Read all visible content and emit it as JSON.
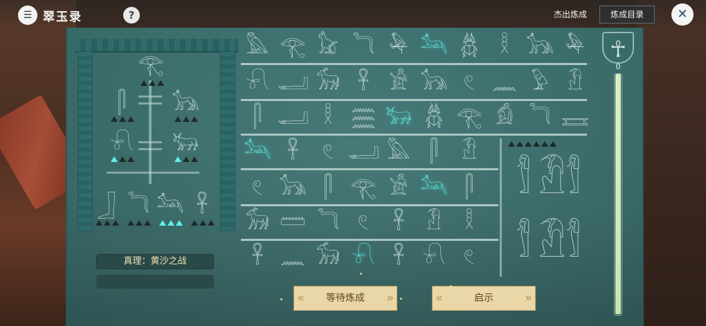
{
  "header": {
    "app_title": "翠玉录",
    "logo_glyph": "☰",
    "help_glyph": "?",
    "excellent_label": "杰出炼成",
    "catalog_label": "炼成目录",
    "close_glyph": "✕"
  },
  "left_panel": {
    "truth_label": "真理：黄沙之战",
    "tree_glyphs": [
      "𓂀",
      "𓋴",
      "𓃥",
      "𓍯",
      "𓃒",
      "𓃀",
      "𓆓",
      "𓃢",
      "𓋹"
    ]
  },
  "grid": {
    "rows": [
      [
        "𓅓",
        "𓂀",
        "𓃠",
        "𓆓",
        "𓅆",
        "𓃢",
        "𓆣",
        "𓎛",
        "𓃥",
        "𓅆"
      ],
      [
        "𓍯",
        "𓂝",
        "𓃘",
        "𓋹",
        "𓀀",
        "𓃥",
        "𓏲",
        "𓈖",
        "𓅱",
        "𓁟"
      ],
      [
        "𓋴",
        "𓂝",
        "𓎛",
        "𓈗",
        "𓃒",
        "𓆣",
        "𓂀",
        "𓀁",
        "𓆓",
        "𓈘"
      ],
      [
        "𓃢",
        "𓋹",
        "𓏲",
        "𓂝",
        "𓅓",
        "𓋴",
        "𓁟"
      ],
      [
        "𓏲",
        "𓃥",
        "𓋴",
        "𓂀",
        "𓀀",
        "𓃢",
        "𓋴"
      ],
      [
        "𓃘",
        "𓏠",
        "𓆓",
        "𓏲",
        "𓋹",
        "𓁟",
        "𓎛"
      ],
      [
        "𓋹",
        "𓈖",
        "𓃘",
        "𓍯",
        "𓋹",
        "𓍯",
        "𓏲"
      ]
    ],
    "highlights": [
      [
        0,
        5
      ],
      [
        2,
        4
      ],
      [
        3,
        0
      ],
      [
        4,
        5
      ],
      [
        6,
        3
      ]
    ]
  },
  "progress": {
    "value_label": "0",
    "ankh_glyph": "☥",
    "fill_fraction": 1.0
  },
  "buttons": {
    "wait_label": "等待炼成",
    "hint_label": "启示"
  },
  "colors": {
    "tablet": "#3b6f6d",
    "highlight": "#5ef0ea",
    "button_bg": "#e9d7a8"
  }
}
